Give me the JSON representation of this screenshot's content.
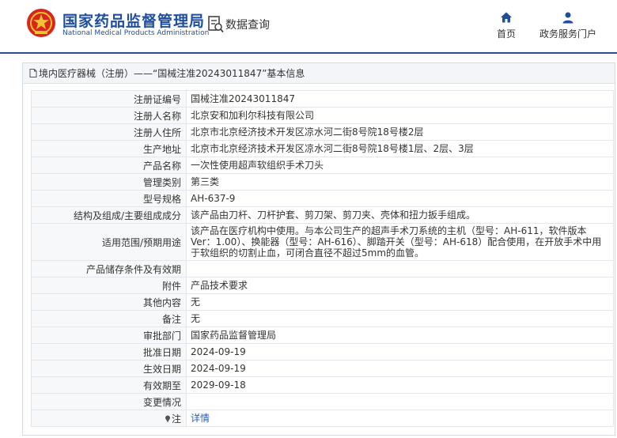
{
  "header": {
    "brand_cn": "国家药品监督管理局",
    "brand_en": "National Medical Products Administration",
    "data_query_label": "数据查询",
    "nav": {
      "home_label": "首页",
      "service_label": "政务服务门户"
    },
    "accent_color": "#1f4e9e"
  },
  "breadcrumb": {
    "text": "境内医疗器械（注册）——“国械注准20243011847”基本信息"
  },
  "details": {
    "rows": [
      {
        "label": "注册证编号",
        "value": "国械注准20243011847"
      },
      {
        "label": "注册人名称",
        "value": "北京安和加利尔科技有限公司"
      },
      {
        "label": "注册人住所",
        "value": "北京市北京经济技术开发区凉水河二街8号院18号楼2层"
      },
      {
        "label": "生产地址",
        "value": "北京市北京经济技术开发区凉水河二街8号院18号楼1层、2层、3层"
      },
      {
        "label": "产品名称",
        "value": "一次性使用超声软组织手术刀头"
      },
      {
        "label": "管理类别",
        "value": "第三类"
      },
      {
        "label": "型号规格",
        "value": "AH-637-9"
      },
      {
        "label": "结构及组成/主要组成成分",
        "value": "该产品由刀杆、刀杆护套、剪刀架、剪刀夹、壳体和扭力扳手组成。"
      },
      {
        "label": "适用范围/预期用途",
        "value": "该产品在医疗机构中使用。与本公司生产的超声手术刀系统的主机（型号：AH-611，软件版本Ver：1.00）、换能器（型号：AH-616）、脚踏开关（型号：AH-618）配合使用，在开放手术中用于软组织的切割止血，可闭合直径不超过5mm的血管。"
      },
      {
        "label": "产品储存条件及有效期",
        "value": ""
      },
      {
        "label": "附件",
        "value": "产品技术要求"
      },
      {
        "label": "其他内容",
        "value": "无"
      },
      {
        "label": "备注",
        "value": "无"
      },
      {
        "label": "审批部门",
        "value": "国家药品监督管理局"
      },
      {
        "label": "批准日期",
        "value": "2024-09-19"
      },
      {
        "label": "生效日期",
        "value": "2024-09-19"
      },
      {
        "label": "有效期至",
        "value": "2029-09-18"
      },
      {
        "label": "变更情况",
        "value": ""
      },
      {
        "label": "注",
        "value": "详情"
      }
    ]
  }
}
